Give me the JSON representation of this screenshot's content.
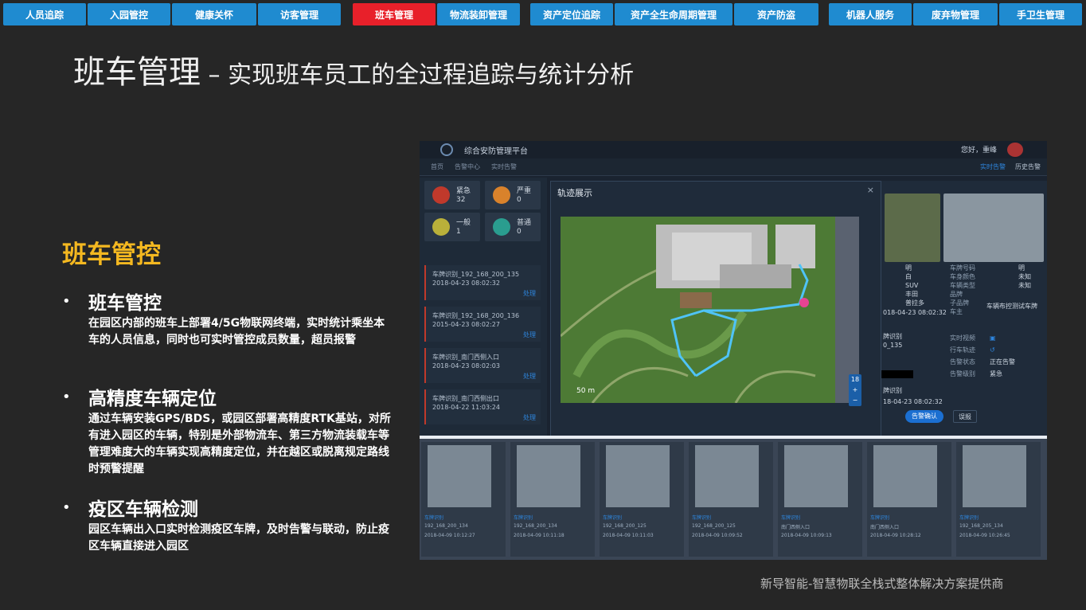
{
  "nav": {
    "tabs": [
      {
        "label": "人员追踪"
      },
      {
        "label": "入园管控"
      },
      {
        "label": "健康关怀"
      },
      {
        "label": "访客管理"
      },
      {
        "label": "班车管理",
        "active": true
      },
      {
        "label": "物流装卸管理"
      },
      {
        "label": "资产定位追踪"
      },
      {
        "label": "资产全生命周期管理"
      },
      {
        "label": "资产防盗"
      },
      {
        "label": "机器人服务"
      },
      {
        "label": "废弃物管理"
      },
      {
        "label": "手卫生管理"
      }
    ],
    "active_color": "#e8202a",
    "tab_color": "#1f8bd0"
  },
  "title": {
    "main": "班车管理",
    "sub": " – 实现班车员工的全过程追踪与统计分析"
  },
  "section": {
    "heading": "班车管控",
    "heading_color": "#f4b820"
  },
  "items": [
    {
      "heading": "班车管控",
      "text": "在园区内部的班车上部署4/5G物联网终端，实时统计乘坐本车的人员信息，同时也可实时管控成员数量，超员报警"
    },
    {
      "heading": "高精度车辆定位",
      "text": "通过车辆安装GPS/BDS，或园区部署高精度RTK基站，对所有进入园区的车辆，特别是外部物流车、第三方物流装载车等管理难度大的车辆实现高精度定位，并在越区或脱离规定路线时预警提醒"
    },
    {
      "heading": "疫区车辆检测",
      "text": "园区车辆出入口实时检测疫区车牌，及时告警与联动，防止疫区车辆直接进入园区"
    }
  ],
  "screenshot": {
    "app_title": "综合安防管理平台",
    "user": "您好，重峰",
    "breadcrumb": [
      "首页",
      "告警中心",
      "实时告警"
    ],
    "right_tabs": [
      "实时告警",
      "历史告警"
    ],
    "alarm_counts": [
      {
        "label": "紧急",
        "value": "32",
        "color": "#c0392b"
      },
      {
        "label": "严重",
        "value": "0",
        "color": "#d9822b"
      },
      {
        "label": "一般",
        "value": "1",
        "color": "#b9b03a"
      },
      {
        "label": "普通",
        "value": "0",
        "color": "#2a9d8f"
      }
    ],
    "alarm_list": [
      {
        "title": "车牌识别_192_168_200_135",
        "time": "2018-04-23 08:02:32",
        "action": "处理"
      },
      {
        "title": "车牌识别_192_168_200_136",
        "time": "2015-04-23 08:02:27",
        "action": "处理"
      },
      {
        "title": "车牌识别_南门西侧入口",
        "time": "2018-04-23 08:02:03",
        "action": "处理"
      },
      {
        "title": "车牌识别_南门西侧出口",
        "time": "2018-04-22 11:03:24",
        "action": "处理"
      }
    ],
    "track": {
      "title": "轨迹展示",
      "close": "×",
      "scale": "50 m",
      "zoom_level": "18",
      "zoom_in": "+",
      "zoom_out": "−"
    },
    "vehicle": {
      "labels": [
        "车牌号码",
        "车身颜色",
        "车辆类型",
        "品牌",
        "子品牌",
        "车主"
      ],
      "values": [
        "明",
        "白",
        "SUV",
        "丰田",
        "普拉多",
        ""
      ],
      "right_values": [
        "明",
        "未知",
        "未知"
      ],
      "owner_note": "车辆布控测试车牌",
      "time": "018-04-23 08:02:32",
      "device_label": "牌识别",
      "device_id": "0_135",
      "status_labels": [
        "实时视频",
        "行车轨迹",
        "告警状态",
        "告警级别"
      ],
      "status_values": [
        "",
        "",
        "正在告警",
        "紧急"
      ],
      "bottom_device": "牌识别",
      "bottom_time": "18-04-23 08:02:32",
      "confirm_btn": "告警确认",
      "ignore_btn": "误报"
    },
    "photos": [
      {
        "tag": "车牌识别",
        "ip": "192_168_200_134",
        "time": "2018-04-09 10:12:27"
      },
      {
        "tag": "车牌识别",
        "ip": "192_168_200_134",
        "time": "2018-04-09 10:11:18"
      },
      {
        "tag": "车牌识别",
        "ip": "192_168_200_125",
        "time": "2018-04-09 10:11:03"
      },
      {
        "tag": "车牌识别",
        "ip": "192_168_200_125",
        "time": "2018-04-09 10:09:52"
      },
      {
        "tag": "车牌识别",
        "ip": "南门西侧入口",
        "time": "2018-04-09 10:09:13"
      },
      {
        "tag": "车牌识别",
        "ip": "南门西侧入口",
        "time": "2018-04-09 10:28:12"
      },
      {
        "tag": "车牌识别",
        "ip": "192_168_205_134",
        "time": "2018-04-09 10:26:45"
      }
    ]
  },
  "footer": "新导智能-智慧物联全栈式整体解决方案提供商"
}
